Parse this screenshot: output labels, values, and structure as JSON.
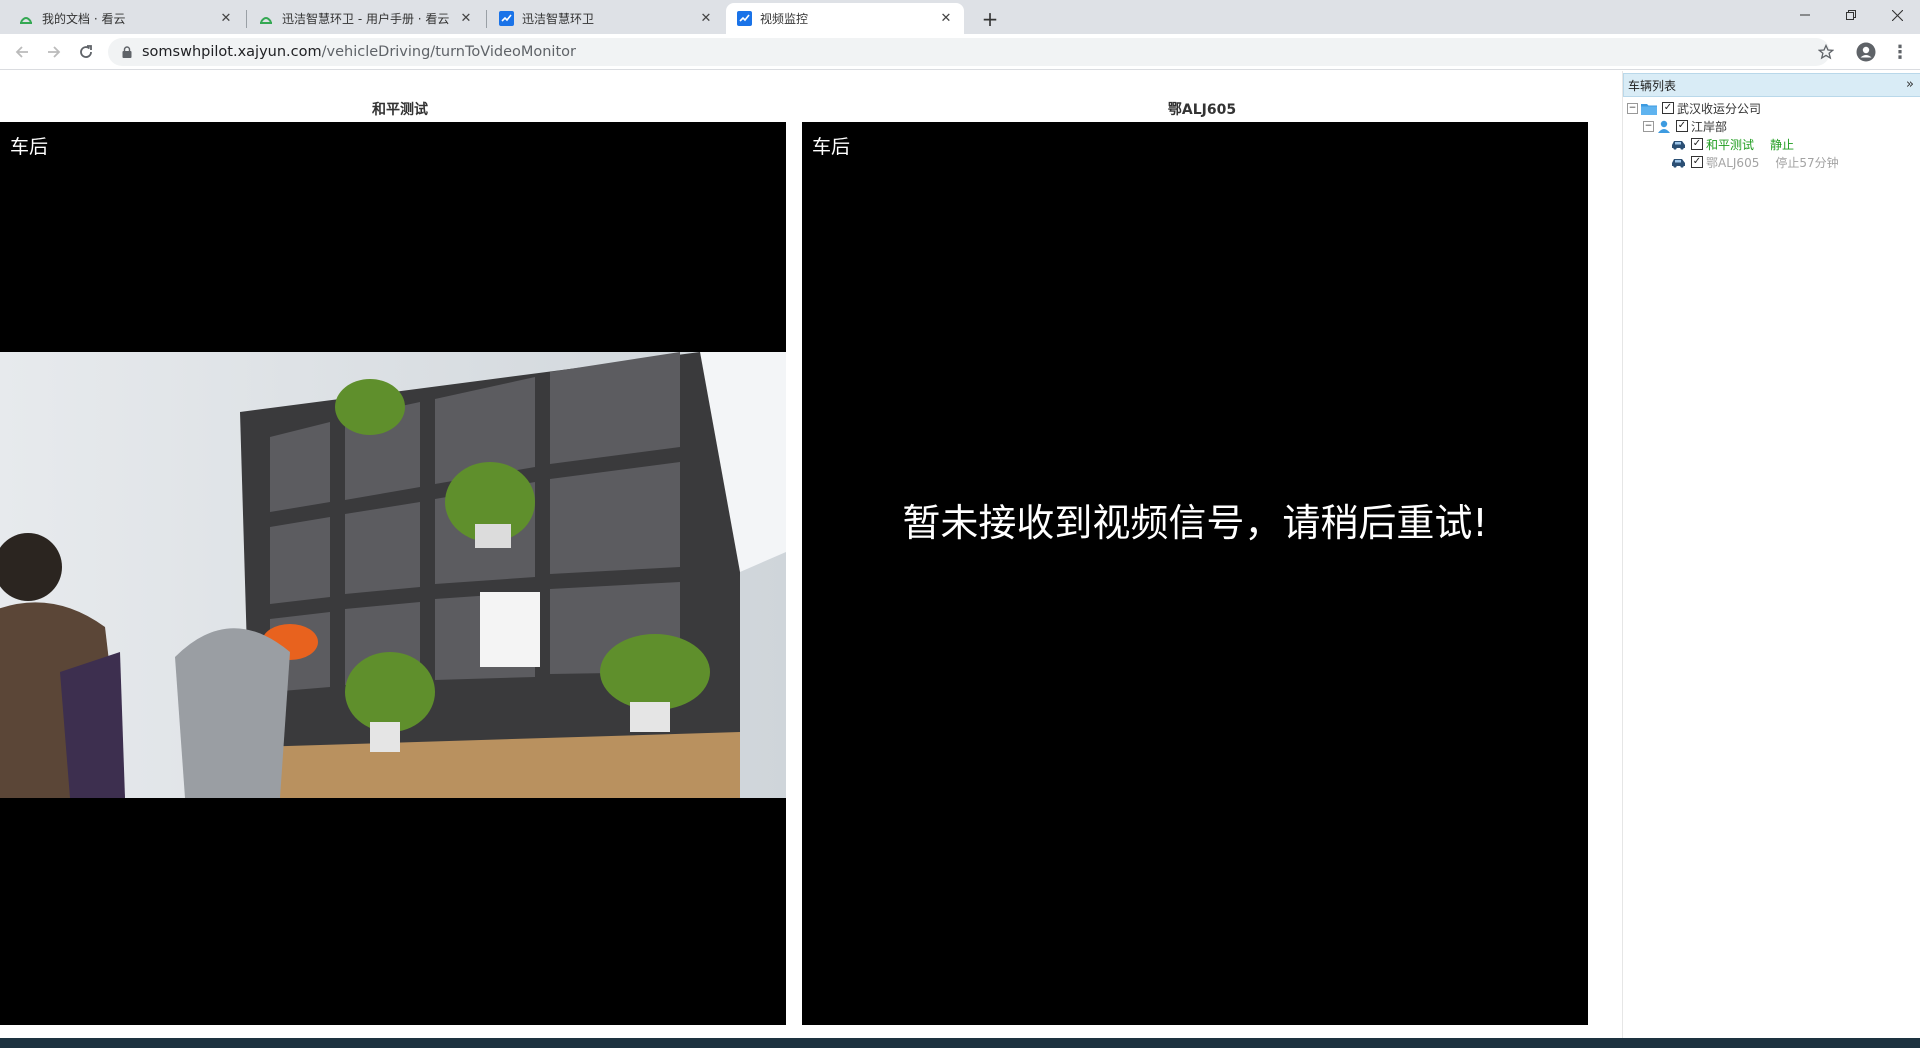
{
  "browser": {
    "tabs": [
      {
        "title": "我的文档 · 看云",
        "active": false
      },
      {
        "title": "迅洁智慧环卫 - 用户手册 · 看云",
        "active": false
      },
      {
        "title": "迅洁智慧环卫",
        "active": false
      },
      {
        "title": "视频监控",
        "active": true
      }
    ],
    "url_host": "somswhpilot.xajyun.com",
    "url_path": "/vehicleDriving/turnToVideoMonitor"
  },
  "monitor": {
    "panels": [
      {
        "title": "和平测试",
        "camera_label": "车后",
        "message": ""
      },
      {
        "title": "鄂ALJ605",
        "camera_label": "车后",
        "message": "暂未接收到视频信号，请稍后重试!"
      }
    ]
  },
  "vehicle_list": {
    "header": "车辆列表",
    "company": "武汉收运分公司",
    "department": "江岸部",
    "vehicles": [
      {
        "name": "和平测试",
        "status": "静止",
        "color": "#1f9d1f"
      },
      {
        "name": "鄂ALJ605",
        "status": "停止57分钟",
        "color": "#a3a3a3"
      }
    ]
  }
}
